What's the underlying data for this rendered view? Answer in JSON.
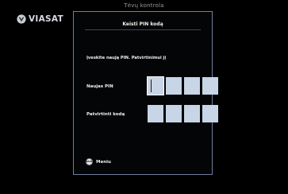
{
  "header": {
    "title": "Tėvų kontrola"
  },
  "logo": {
    "text": "VIASAT",
    "icon": "viasat-logo-icon"
  },
  "dialog": {
    "title": "Keisti PIN kodą",
    "instruction": "Įveskite naują PIN. Patvirtinimui jį",
    "new_pin_label": "Naujas PIN",
    "confirm_pin_label": "Patvirtinti kodą",
    "pin_length": 4,
    "active_field": "new-pin-digit-1",
    "menu_label": "Meniu",
    "menu_icon_text": "BACK",
    "menu_icon": "back-button-icon"
  },
  "colors": {
    "background": "#000000",
    "dialog_border": "#6e7f9c",
    "pin_box": "#c8d5e6",
    "title": "#9a9a9a"
  }
}
